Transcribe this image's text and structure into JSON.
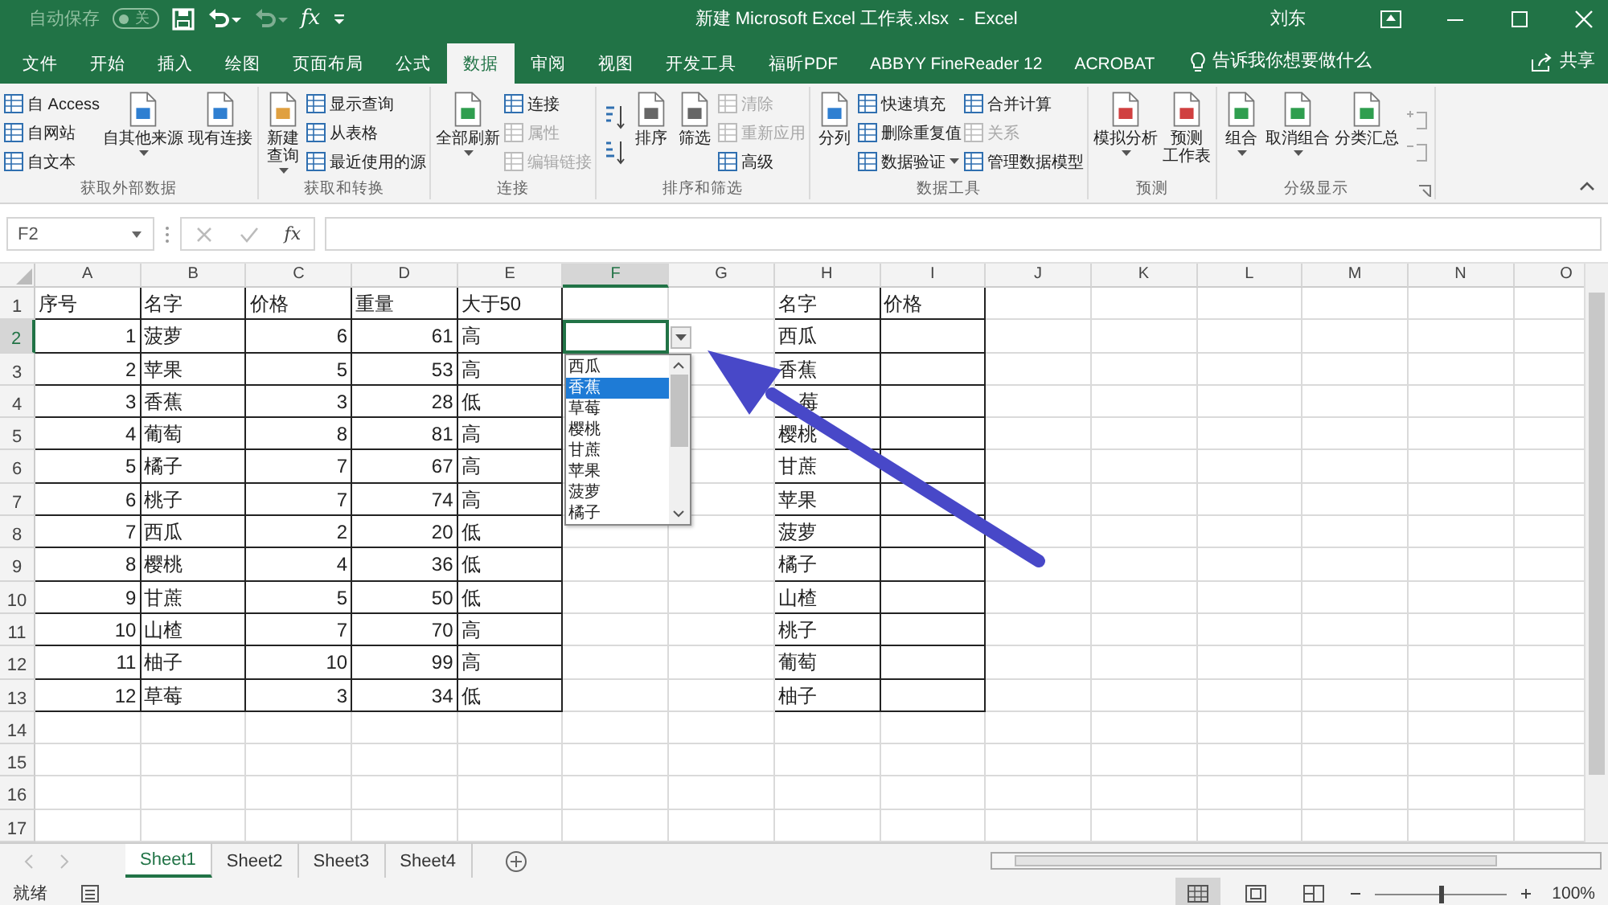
{
  "title_bar": {
    "autosave": {
      "label": "自动保存",
      "on": false,
      "state_text": "关"
    },
    "quick_access": [
      {
        "kind": "save"
      },
      {
        "kind": "undo",
        "disabled": false,
        "caret": true
      },
      {
        "kind": "redo",
        "disabled": true,
        "caret": true
      },
      {
        "kind": "formula",
        "symbol": "fx"
      },
      {
        "kind": "customize"
      }
    ],
    "title": "新建 Microsoft Excel 工作表.xlsx  -  Excel",
    "user": "刘东"
  },
  "menu_tabs": [
    {
      "label": "文件",
      "selected": false
    },
    {
      "label": "开始",
      "selected": false
    },
    {
      "label": "插入",
      "selected": false
    },
    {
      "label": "绘图",
      "selected": false
    },
    {
      "label": "页面布局",
      "selected": false
    },
    {
      "label": "公式",
      "selected": false
    },
    {
      "label": "数据",
      "selected": true
    },
    {
      "label": "审阅",
      "selected": false
    },
    {
      "label": "视图",
      "selected": false
    },
    {
      "label": "开发工具",
      "selected": false
    },
    {
      "label": "福昕PDF",
      "selected": false
    },
    {
      "label": "ABBYY FineReader 12",
      "selected": false
    },
    {
      "label": "ACROBAT",
      "selected": false
    }
  ],
  "tell_me": "告诉我你想要做什么",
  "share": "共享",
  "ribbon": {
    "groups": [
      {
        "label": "获取外部数据",
        "launcher": false,
        "items": [
          {
            "kind": "stack",
            "items": [
              {
                "label": "自 Access",
                "disabled": false,
                "caret": false
              },
              {
                "label": "自网站",
                "disabled": false,
                "caret": false
              },
              {
                "label": "自文本",
                "disabled": false,
                "caret": false
              }
            ]
          },
          {
            "kind": "large",
            "lines": [
              "自其他来源"
            ],
            "caret": true
          },
          {
            "kind": "large",
            "lines": [
              "现有连接"
            ],
            "caret": false
          }
        ]
      },
      {
        "label": "获取和转换",
        "launcher": false,
        "items": [
          {
            "kind": "large",
            "lines": [
              "新建",
              "查询"
            ],
            "caret": true
          },
          {
            "kind": "stack",
            "items": [
              {
                "label": "显示查询",
                "disabled": false,
                "caret": false
              },
              {
                "label": "从表格",
                "disabled": false,
                "caret": false
              },
              {
                "label": "最近使用的源",
                "disabled": false,
                "caret": false
              }
            ]
          }
        ]
      },
      {
        "label": "连接",
        "launcher": false,
        "items": [
          {
            "kind": "large",
            "lines": [
              "全部刷新"
            ],
            "caret": true
          },
          {
            "kind": "stack",
            "items": [
              {
                "label": "连接",
                "disabled": false,
                "caret": false
              },
              {
                "label": "属性",
                "disabled": true,
                "caret": false
              },
              {
                "label": "编辑链接",
                "disabled": true,
                "caret": false
              }
            ]
          }
        ]
      },
      {
        "label": "排序和筛选",
        "launcher": false,
        "items": [
          {
            "kind": "sort-pair"
          },
          {
            "kind": "large",
            "lines": [
              "排序"
            ],
            "caret": false
          },
          {
            "kind": "large",
            "lines": [
              "筛选"
            ],
            "caret": false
          },
          {
            "kind": "stack",
            "items": [
              {
                "label": "清除",
                "disabled": true,
                "caret": false
              },
              {
                "label": "重新应用",
                "disabled": true,
                "caret": false
              },
              {
                "label": "高级",
                "disabled": false,
                "caret": false
              }
            ]
          }
        ]
      },
      {
        "label": "数据工具",
        "launcher": false,
        "items": [
          {
            "kind": "large",
            "lines": [
              "分列"
            ],
            "caret": false
          },
          {
            "kind": "stack",
            "items": [
              {
                "label": "快速填充",
                "disabled": false,
                "caret": false
              },
              {
                "label": "删除重复值",
                "disabled": false,
                "caret": false
              },
              {
                "label": "数据验证",
                "disabled": false,
                "caret": true
              }
            ]
          },
          {
            "kind": "stack",
            "items": [
              {
                "label": "合并计算",
                "disabled": false,
                "caret": false
              },
              {
                "label": "关系",
                "disabled": true,
                "caret": false
              },
              {
                "label": "管理数据模型",
                "disabled": false,
                "caret": false
              }
            ]
          }
        ]
      },
      {
        "label": "预测",
        "launcher": false,
        "items": [
          {
            "kind": "large",
            "lines": [
              "模拟分析"
            ],
            "caret": true
          },
          {
            "kind": "large",
            "lines": [
              "预测",
              "工作表"
            ],
            "caret": false
          }
        ]
      },
      {
        "label": "分级显示",
        "launcher": true,
        "items": [
          {
            "kind": "large",
            "lines": [
              "组合"
            ],
            "caret": true
          },
          {
            "kind": "large",
            "lines": [
              "取消组合"
            ],
            "caret": true
          },
          {
            "kind": "large",
            "lines": [
              "分类汇总"
            ],
            "caret": false
          },
          {
            "kind": "detail-pair"
          }
        ]
      }
    ]
  },
  "formula_bar": {
    "name_box": "F2",
    "function_symbol": "fx"
  },
  "columns": [
    {
      "label": "A",
      "selected": false
    },
    {
      "label": "B",
      "selected": false
    },
    {
      "label": "C",
      "selected": false
    },
    {
      "label": "D",
      "selected": false
    },
    {
      "label": "E",
      "selected": false
    },
    {
      "label": "F",
      "selected": true
    },
    {
      "label": "G",
      "selected": false
    },
    {
      "label": "H",
      "selected": false
    },
    {
      "label": "I",
      "selected": false
    },
    {
      "label": "J",
      "selected": false
    },
    {
      "label": "K",
      "selected": false
    },
    {
      "label": "L",
      "selected": false
    },
    {
      "label": "M",
      "selected": false
    },
    {
      "label": "N",
      "selected": false
    },
    {
      "label": "O",
      "selected": false
    }
  ],
  "rows": [
    {
      "number": "1",
      "selected": false,
      "cells": [
        {
          "text": "序号",
          "kind": "text"
        },
        {
          "text": "名字",
          "kind": "text"
        },
        {
          "text": "价格",
          "kind": "text"
        },
        {
          "text": "重量",
          "kind": "text"
        },
        {
          "text": "大于50",
          "kind": "text"
        },
        null,
        null,
        {
          "text": "名字",
          "kind": "text"
        },
        {
          "text": "价格",
          "kind": "text"
        }
      ]
    },
    {
      "number": "2",
      "selected": true,
      "cells": [
        {
          "text": "1",
          "kind": "number"
        },
        {
          "text": "菠萝",
          "kind": "text"
        },
        {
          "text": "6",
          "kind": "number"
        },
        {
          "text": "61",
          "kind": "number"
        },
        {
          "text": "高",
          "kind": "text"
        },
        null,
        null,
        {
          "text": "西瓜",
          "kind": "text"
        }
      ]
    },
    {
      "number": "3",
      "selected": false,
      "cells": [
        {
          "text": "2",
          "kind": "number"
        },
        {
          "text": "苹果",
          "kind": "text"
        },
        {
          "text": "5",
          "kind": "number"
        },
        {
          "text": "53",
          "kind": "number"
        },
        {
          "text": "高",
          "kind": "text"
        },
        null,
        null,
        {
          "text": "香蕉",
          "kind": "text"
        }
      ]
    },
    {
      "number": "4",
      "selected": false,
      "cells": [
        {
          "text": "3",
          "kind": "number"
        },
        {
          "text": "香蕉",
          "kind": "text"
        },
        {
          "text": "3",
          "kind": "number"
        },
        {
          "text": "28",
          "kind": "number"
        },
        {
          "text": "低",
          "kind": "text"
        },
        null,
        null,
        {
          "text": "莓",
          "kind": "covered"
        }
      ]
    },
    {
      "number": "5",
      "selected": false,
      "cells": [
        {
          "text": "4",
          "kind": "number"
        },
        {
          "text": "葡萄",
          "kind": "text"
        },
        {
          "text": "8",
          "kind": "number"
        },
        {
          "text": "81",
          "kind": "number"
        },
        {
          "text": "高",
          "kind": "text"
        },
        null,
        null,
        {
          "text": "樱桃",
          "kind": "text"
        }
      ]
    },
    {
      "number": "6",
      "selected": false,
      "cells": [
        {
          "text": "5",
          "kind": "number"
        },
        {
          "text": "橘子",
          "kind": "text"
        },
        {
          "text": "7",
          "kind": "number"
        },
        {
          "text": "67",
          "kind": "number"
        },
        {
          "text": "高",
          "kind": "text"
        },
        null,
        null,
        {
          "text": "甘蔗",
          "kind": "text"
        }
      ]
    },
    {
      "number": "7",
      "selected": false,
      "cells": [
        {
          "text": "6",
          "kind": "number"
        },
        {
          "text": "桃子",
          "kind": "text"
        },
        {
          "text": "7",
          "kind": "number"
        },
        {
          "text": "74",
          "kind": "number"
        },
        {
          "text": "高",
          "kind": "text"
        },
        null,
        null,
        {
          "text": "苹果",
          "kind": "text"
        }
      ]
    },
    {
      "number": "8",
      "selected": false,
      "cells": [
        {
          "text": "7",
          "kind": "number"
        },
        {
          "text": "西瓜",
          "kind": "text"
        },
        {
          "text": "2",
          "kind": "number"
        },
        {
          "text": "20",
          "kind": "number"
        },
        {
          "text": "低",
          "kind": "text"
        },
        null,
        null,
        {
          "text": "菠萝",
          "kind": "text"
        }
      ]
    },
    {
      "number": "9",
      "selected": false,
      "cells": [
        {
          "text": "8",
          "kind": "number"
        },
        {
          "text": "樱桃",
          "kind": "text"
        },
        {
          "text": "4",
          "kind": "number"
        },
        {
          "text": "36",
          "kind": "number"
        },
        {
          "text": "低",
          "kind": "text"
        },
        null,
        null,
        {
          "text": "橘子",
          "kind": "text"
        }
      ]
    },
    {
      "number": "10",
      "selected": false,
      "cells": [
        {
          "text": "9",
          "kind": "number"
        },
        {
          "text": "甘蔗",
          "kind": "text"
        },
        {
          "text": "5",
          "kind": "number"
        },
        {
          "text": "50",
          "kind": "number"
        },
        {
          "text": "低",
          "kind": "text"
        },
        null,
        null,
        {
          "text": "山楂",
          "kind": "text"
        }
      ]
    },
    {
      "number": "11",
      "selected": false,
      "cells": [
        {
          "text": "10",
          "kind": "number"
        },
        {
          "text": "山楂",
          "kind": "text"
        },
        {
          "text": "7",
          "kind": "number"
        },
        {
          "text": "70",
          "kind": "number"
        },
        {
          "text": "高",
          "kind": "text"
        },
        null,
        null,
        {
          "text": "桃子",
          "kind": "text"
        }
      ]
    },
    {
      "number": "12",
      "selected": false,
      "cells": [
        {
          "text": "11",
          "kind": "number"
        },
        {
          "text": "柚子",
          "kind": "text"
        },
        {
          "text": "10",
          "kind": "number"
        },
        {
          "text": "99",
          "kind": "number"
        },
        {
          "text": "高",
          "kind": "text"
        },
        null,
        null,
        {
          "text": "葡萄",
          "kind": "text"
        }
      ]
    },
    {
      "number": "13",
      "selected": false,
      "cells": [
        {
          "text": "12",
          "kind": "number"
        },
        {
          "text": "草莓",
          "kind": "text"
        },
        {
          "text": "3",
          "kind": "number"
        },
        {
          "text": "34",
          "kind": "number"
        },
        {
          "text": "低",
          "kind": "text"
        },
        null,
        null,
        {
          "text": "柚子",
          "kind": "text"
        }
      ]
    },
    {
      "number": "14",
      "selected": false
    },
    {
      "number": "15",
      "selected": false
    },
    {
      "number": "16",
      "selected": false
    },
    {
      "number": "17",
      "selected": false
    }
  ],
  "dropdown": {
    "items": [
      {
        "label": "西瓜",
        "selected": false
      },
      {
        "label": "香蕉",
        "selected": true
      },
      {
        "label": "草莓",
        "selected": false
      },
      {
        "label": "樱桃",
        "selected": false
      },
      {
        "label": "甘蔗",
        "selected": false
      },
      {
        "label": "苹果",
        "selected": false
      },
      {
        "label": "菠萝",
        "selected": false
      },
      {
        "label": "橘子",
        "selected": false
      }
    ]
  },
  "sheet_tabs": [
    {
      "label": "Sheet1",
      "selected": true
    },
    {
      "label": "Sheet2",
      "selected": false
    },
    {
      "label": "Sheet3",
      "selected": false
    },
    {
      "label": "Sheet4",
      "selected": false
    }
  ],
  "status_bar": {
    "ready": "就绪",
    "views": [
      {
        "kind": "normal",
        "selected": true
      },
      {
        "kind": "page-layout",
        "selected": false
      },
      {
        "kind": "page-break",
        "selected": false
      }
    ],
    "zoom": {
      "level": 0.5,
      "text": "100%"
    }
  }
}
